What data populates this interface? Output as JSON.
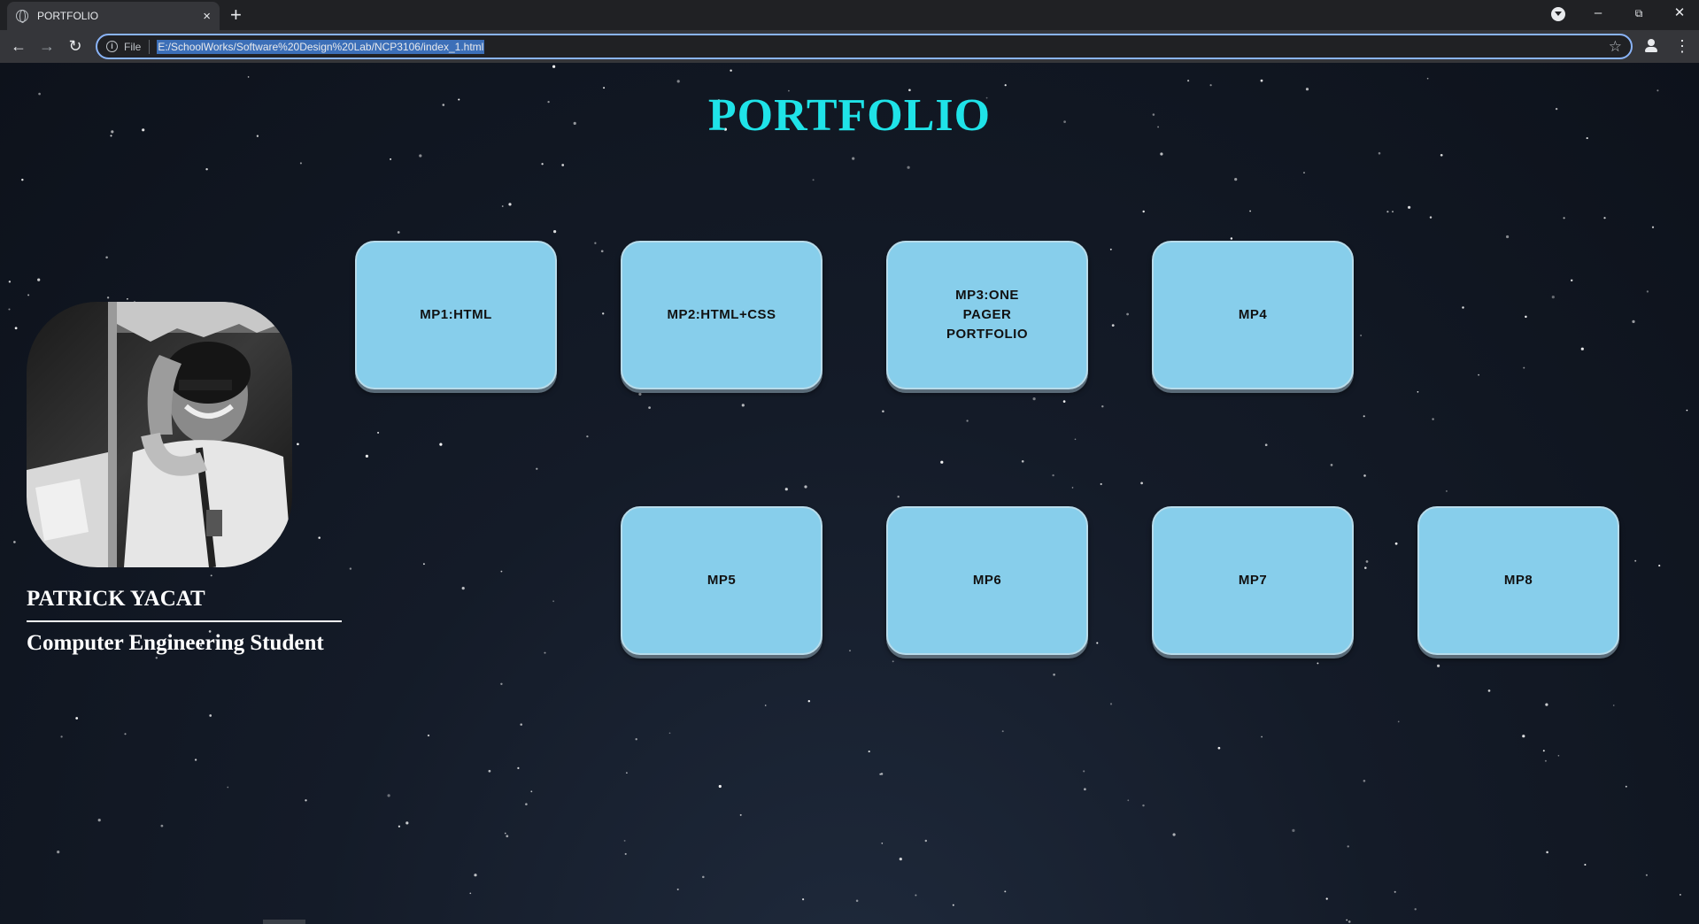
{
  "browser": {
    "tab_title": "PORTFOLIO",
    "tab_close": "×",
    "new_tab": "+",
    "url_scheme": "File",
    "url": "E:/SchoolWorks/Software%20Design%20Lab/NCP3106/index_1.html",
    "icons": [
      "globe-icon",
      "close-icon",
      "plus-icon",
      "back-icon",
      "forward-icon",
      "reload-icon",
      "info-icon",
      "star-icon",
      "profile-icon",
      "menu-icon",
      "minimize-icon",
      "restore-icon",
      "window-close-icon"
    ]
  },
  "page": {
    "heading": "PORTFOLIO",
    "heading_color": "#1fe3e8",
    "profile": {
      "name": "PATRICK YACAT",
      "role": "Computer Engineering Student"
    },
    "projects": [
      {
        "label": "MP1:HTML"
      },
      {
        "label": "MP2:HTML+CSS"
      },
      {
        "label": "MP3:ONE PAGER PORTFOLIO"
      },
      {
        "label": "MP4"
      },
      {
        "label": "MP5"
      },
      {
        "label": "MP6"
      },
      {
        "label": "MP7"
      },
      {
        "label": "MP8"
      }
    ],
    "card_color": "#87ceeb"
  }
}
